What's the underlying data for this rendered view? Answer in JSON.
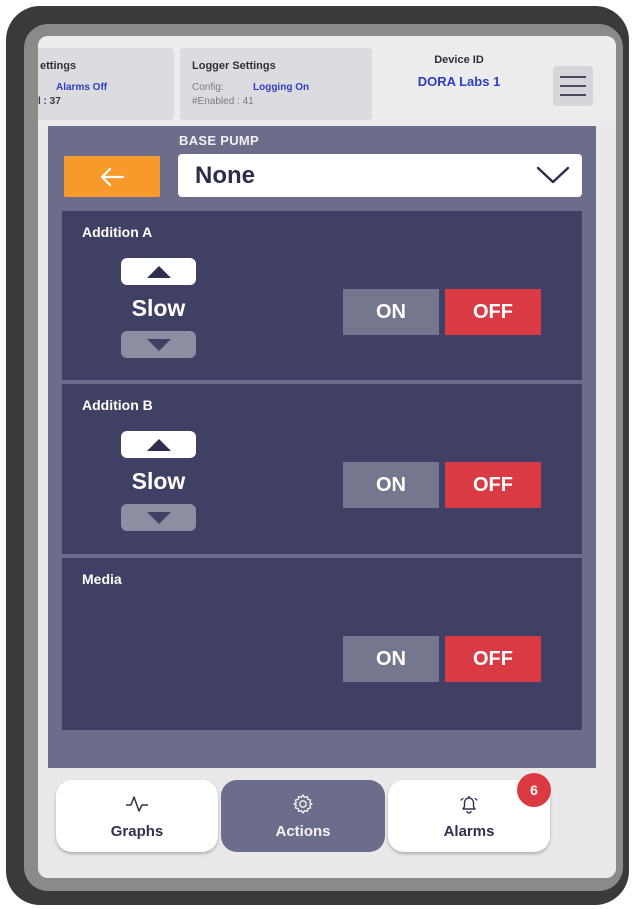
{
  "topbar": {
    "alarm_panel": {
      "title": "ettings",
      "status": "Alarms Off",
      "count": "l : 37"
    },
    "logger_panel": {
      "title": "Logger Settings",
      "config_label": "Config:",
      "config_value": "Logging On",
      "enabled": "#Enabled : 41"
    },
    "device": {
      "label": "Device ID",
      "value": "DORA Labs 1"
    },
    "menu_icon": "hamburger-menu-icon"
  },
  "main": {
    "base_pump_label": "BASE PUMP",
    "back_icon": "arrow-left-icon",
    "dropdown": {
      "value": "None",
      "icon": "chevron-down-icon"
    },
    "pumps": [
      {
        "name": "Addition A",
        "speed": "Slow",
        "on_label": "ON",
        "off_label": "OFF"
      },
      {
        "name": "Addition B",
        "speed": "Slow",
        "on_label": "ON",
        "off_label": "OFF"
      },
      {
        "name": "Media",
        "on_label": "ON",
        "off_label": "OFF"
      }
    ]
  },
  "nav": {
    "graphs": "Graphs",
    "actions": "Actions",
    "alarms": "Alarms",
    "alarm_badge": "6"
  },
  "colors": {
    "accent_orange": "#f79a2b",
    "off_red": "#d93a43",
    "panel_dark": "#3f4064",
    "main_bg": "#6b6d8a",
    "link_blue": "#2d3fbf"
  }
}
